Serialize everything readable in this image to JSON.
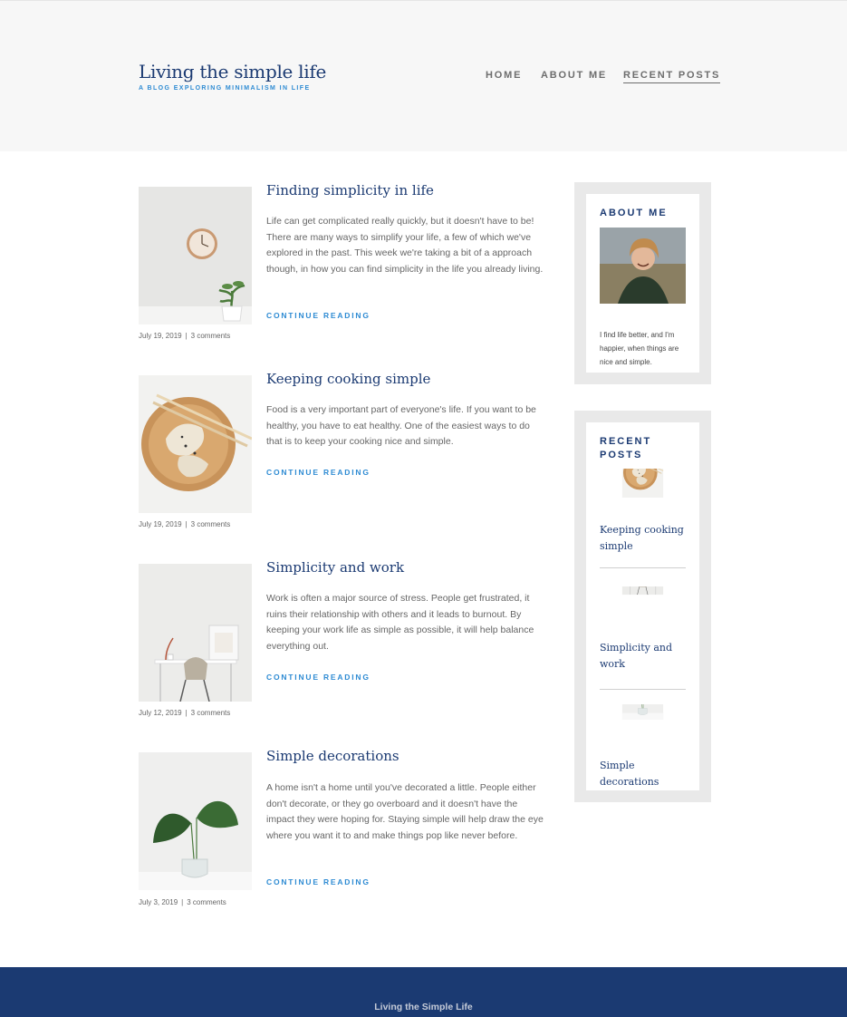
{
  "site": {
    "title": "Living the simple life",
    "tagline": "A BLOG EXPLORING MINIMALISM IN LIFE"
  },
  "nav": [
    {
      "label": "HOME",
      "active": false
    },
    {
      "label": "ABOUT ME",
      "active": false
    },
    {
      "label": "RECENT POSTS",
      "active": true
    }
  ],
  "posts": [
    {
      "title": "Finding simplicity in life",
      "excerpt": "Life can get complicated really quickly, but it doesn't have to be! There are many ways to simplify your life, a few of which we've explored in the past. This week we're taking a bit of a approach though, in how you can find simplicity in the life you already living.",
      "link": "CONTINUE READING",
      "date": "July 19, 2019",
      "comments": "3 comments",
      "image": "clock-and-plant-photo"
    },
    {
      "title": "Keeping cooking simple",
      "excerpt": "Food is a very important part of everyone's life. If you want to be healthy, you have to eat healthy. One of the easiest ways to do that is to keep your cooking nice and simple.",
      "link": "CONTINUE READING",
      "date": "July 19, 2019",
      "comments": "3 comments",
      "image": "dumplings-plate-photo"
    },
    {
      "title": "Simplicity and work",
      "excerpt": "Work is often a major source of stress. People get frustrated, it ruins their relationship with others and it leads to burnout. By keeping your work life as simple as possible, it will help balance everything out.",
      "link": "CONTINUE READING",
      "date": "July 12, 2019",
      "comments": "3 comments",
      "image": "desk-and-chair-photo"
    },
    {
      "title": "Simple decorations",
      "excerpt": "A home isn't a home until you've decorated a little. People either don't decorate, or they go overboard and it doesn't have the impact they were hoping for. Staying simple will help draw the eye where you want it to and make things pop like never before.",
      "link": "CONTINUE READING",
      "date": "July 3, 2019",
      "comments": "3 comments",
      "image": "leaves-in-vase-photo"
    }
  ],
  "meta_separator": "|",
  "sidebar": {
    "about": {
      "title": "ABOUT ME",
      "text": "I find life better, and I'm happier, when things are nice and simple.",
      "image": "author-portrait-photo"
    },
    "recent": {
      "title": "RECENT POSTS",
      "items": [
        {
          "label": "Keeping cooking simple",
          "image": "dumplings-plate-photo"
        },
        {
          "label": "Simplicity and work",
          "image": "desk-and-chair-photo"
        },
        {
          "label": "Simple decorations",
          "image": "leaves-in-vase-photo"
        }
      ]
    }
  },
  "footer": {
    "text": "Living the Simple Life"
  },
  "colors": {
    "brand_navy": "#1b3a72",
    "accent_blue": "#2e8bd3",
    "header_bg": "#f7f7f7",
    "widget_bg": "#e9e9e9"
  }
}
